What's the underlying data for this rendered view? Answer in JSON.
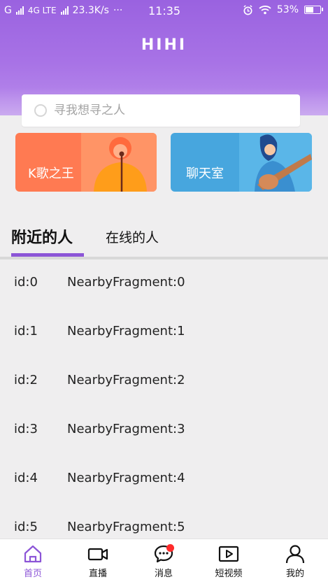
{
  "status_bar": {
    "network": "G",
    "lte": "4G LTE",
    "speed": "23.3K/s",
    "dots": "···",
    "time": "11:35",
    "battery": "53%"
  },
  "header": {
    "logo": "HIHI"
  },
  "search": {
    "placeholder": "寻我想寻之人"
  },
  "cards": [
    {
      "label": "K歌之王",
      "color": "#ff7a52"
    },
    {
      "label": "聊天室",
      "color": "#47a6de"
    }
  ],
  "tabs": [
    {
      "label": "附近的人",
      "active": true
    },
    {
      "label": "在线的人",
      "active": false
    }
  ],
  "list": [
    {
      "id": "id:0",
      "name": "NearbyFragment:0"
    },
    {
      "id": "id:1",
      "name": "NearbyFragment:1"
    },
    {
      "id": "id:2",
      "name": "NearbyFragment:2"
    },
    {
      "id": "id:3",
      "name": "NearbyFragment:3"
    },
    {
      "id": "id:4",
      "name": "NearbyFragment:4"
    },
    {
      "id": "id:5",
      "name": "NearbyFragment:5"
    }
  ],
  "bottom_nav": [
    {
      "label": "首页",
      "icon": "home-icon",
      "active": true
    },
    {
      "label": "直播",
      "icon": "video-camera-icon",
      "active": false
    },
    {
      "label": "消息",
      "icon": "chat-bubble-icon",
      "active": false,
      "badge": true
    },
    {
      "label": "短视频",
      "icon": "play-icon",
      "active": false
    },
    {
      "label": "我的",
      "icon": "user-icon",
      "active": false
    }
  ],
  "colors": {
    "accent": "#8c55d7",
    "header": "#9a62e0",
    "badge": "#ff2a2a"
  }
}
